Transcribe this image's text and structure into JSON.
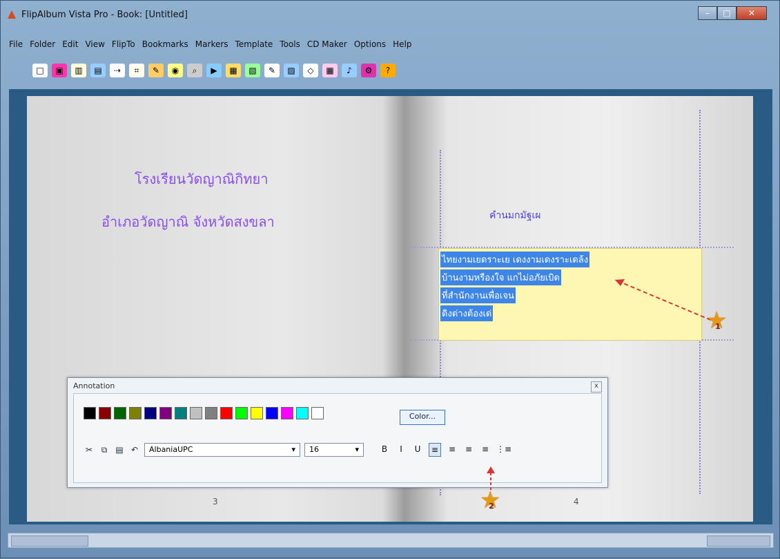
{
  "window": {
    "title": "FlipAlbum Vista Pro - Book: [Untitled]",
    "controls": {
      "minimize": "–",
      "maximize": "□",
      "close": "✕"
    }
  },
  "menu": [
    "File",
    "Folder",
    "Edit",
    "View",
    "FlipTo",
    "Bookmarks",
    "Markers",
    "Template",
    "Tools",
    "CD Maker",
    "Options",
    "Help"
  ],
  "toolbar_icons": [
    "new-icon",
    "open-icon",
    "save-icon",
    "print-icon",
    "undo-icon",
    "cut-icon",
    "copy-icon",
    "paste-icon",
    "zoom-icon",
    "play-icon",
    "thumbnail-icon",
    "overview-icon",
    "text-icon",
    "image-icon",
    "shape-icon",
    "table-icon",
    "sound-icon",
    "settings-icon",
    "help-icon"
  ],
  "book": {
    "left_page": {
      "line1": "โรงเรียนวัดญาณิกิทยา",
      "line2": "อำเภอวัดญาณิ จังหวัดสงขลา",
      "page_number": "3"
    },
    "right_page": {
      "heading": "คำนมกมัฐเผ",
      "note_lines": [
        "ไทยงามเยดราะเย เดงงามเดงราะเดล้ง",
        "บ้านงามหรืองใจ แกไม่อภัยเบิด",
        "ที่สำนักงานเพื่อเจน",
        "ดิงต่างต้องเด่"
      ],
      "page_number": "4"
    }
  },
  "annotation": {
    "title": "Annotation",
    "close": "x",
    "palette": [
      "#000000",
      "#8b0000",
      "#006400",
      "#808000",
      "#000080",
      "#800080",
      "#008080",
      "#c0c0c0",
      "#808080",
      "#ff0000",
      "#00ff00",
      "#ffff00",
      "#0000ff",
      "#ff00ff",
      "#00ffff",
      "#ffffff"
    ],
    "color_button": "Color...",
    "font": "AlbaniaUPC",
    "size": "16",
    "format_buttons": [
      "B",
      "I",
      "U",
      "≡",
      "≡",
      "≡",
      "≡",
      "⋮≡"
    ],
    "active_format_index": 3
  },
  "markers": [
    "1",
    "2"
  ]
}
